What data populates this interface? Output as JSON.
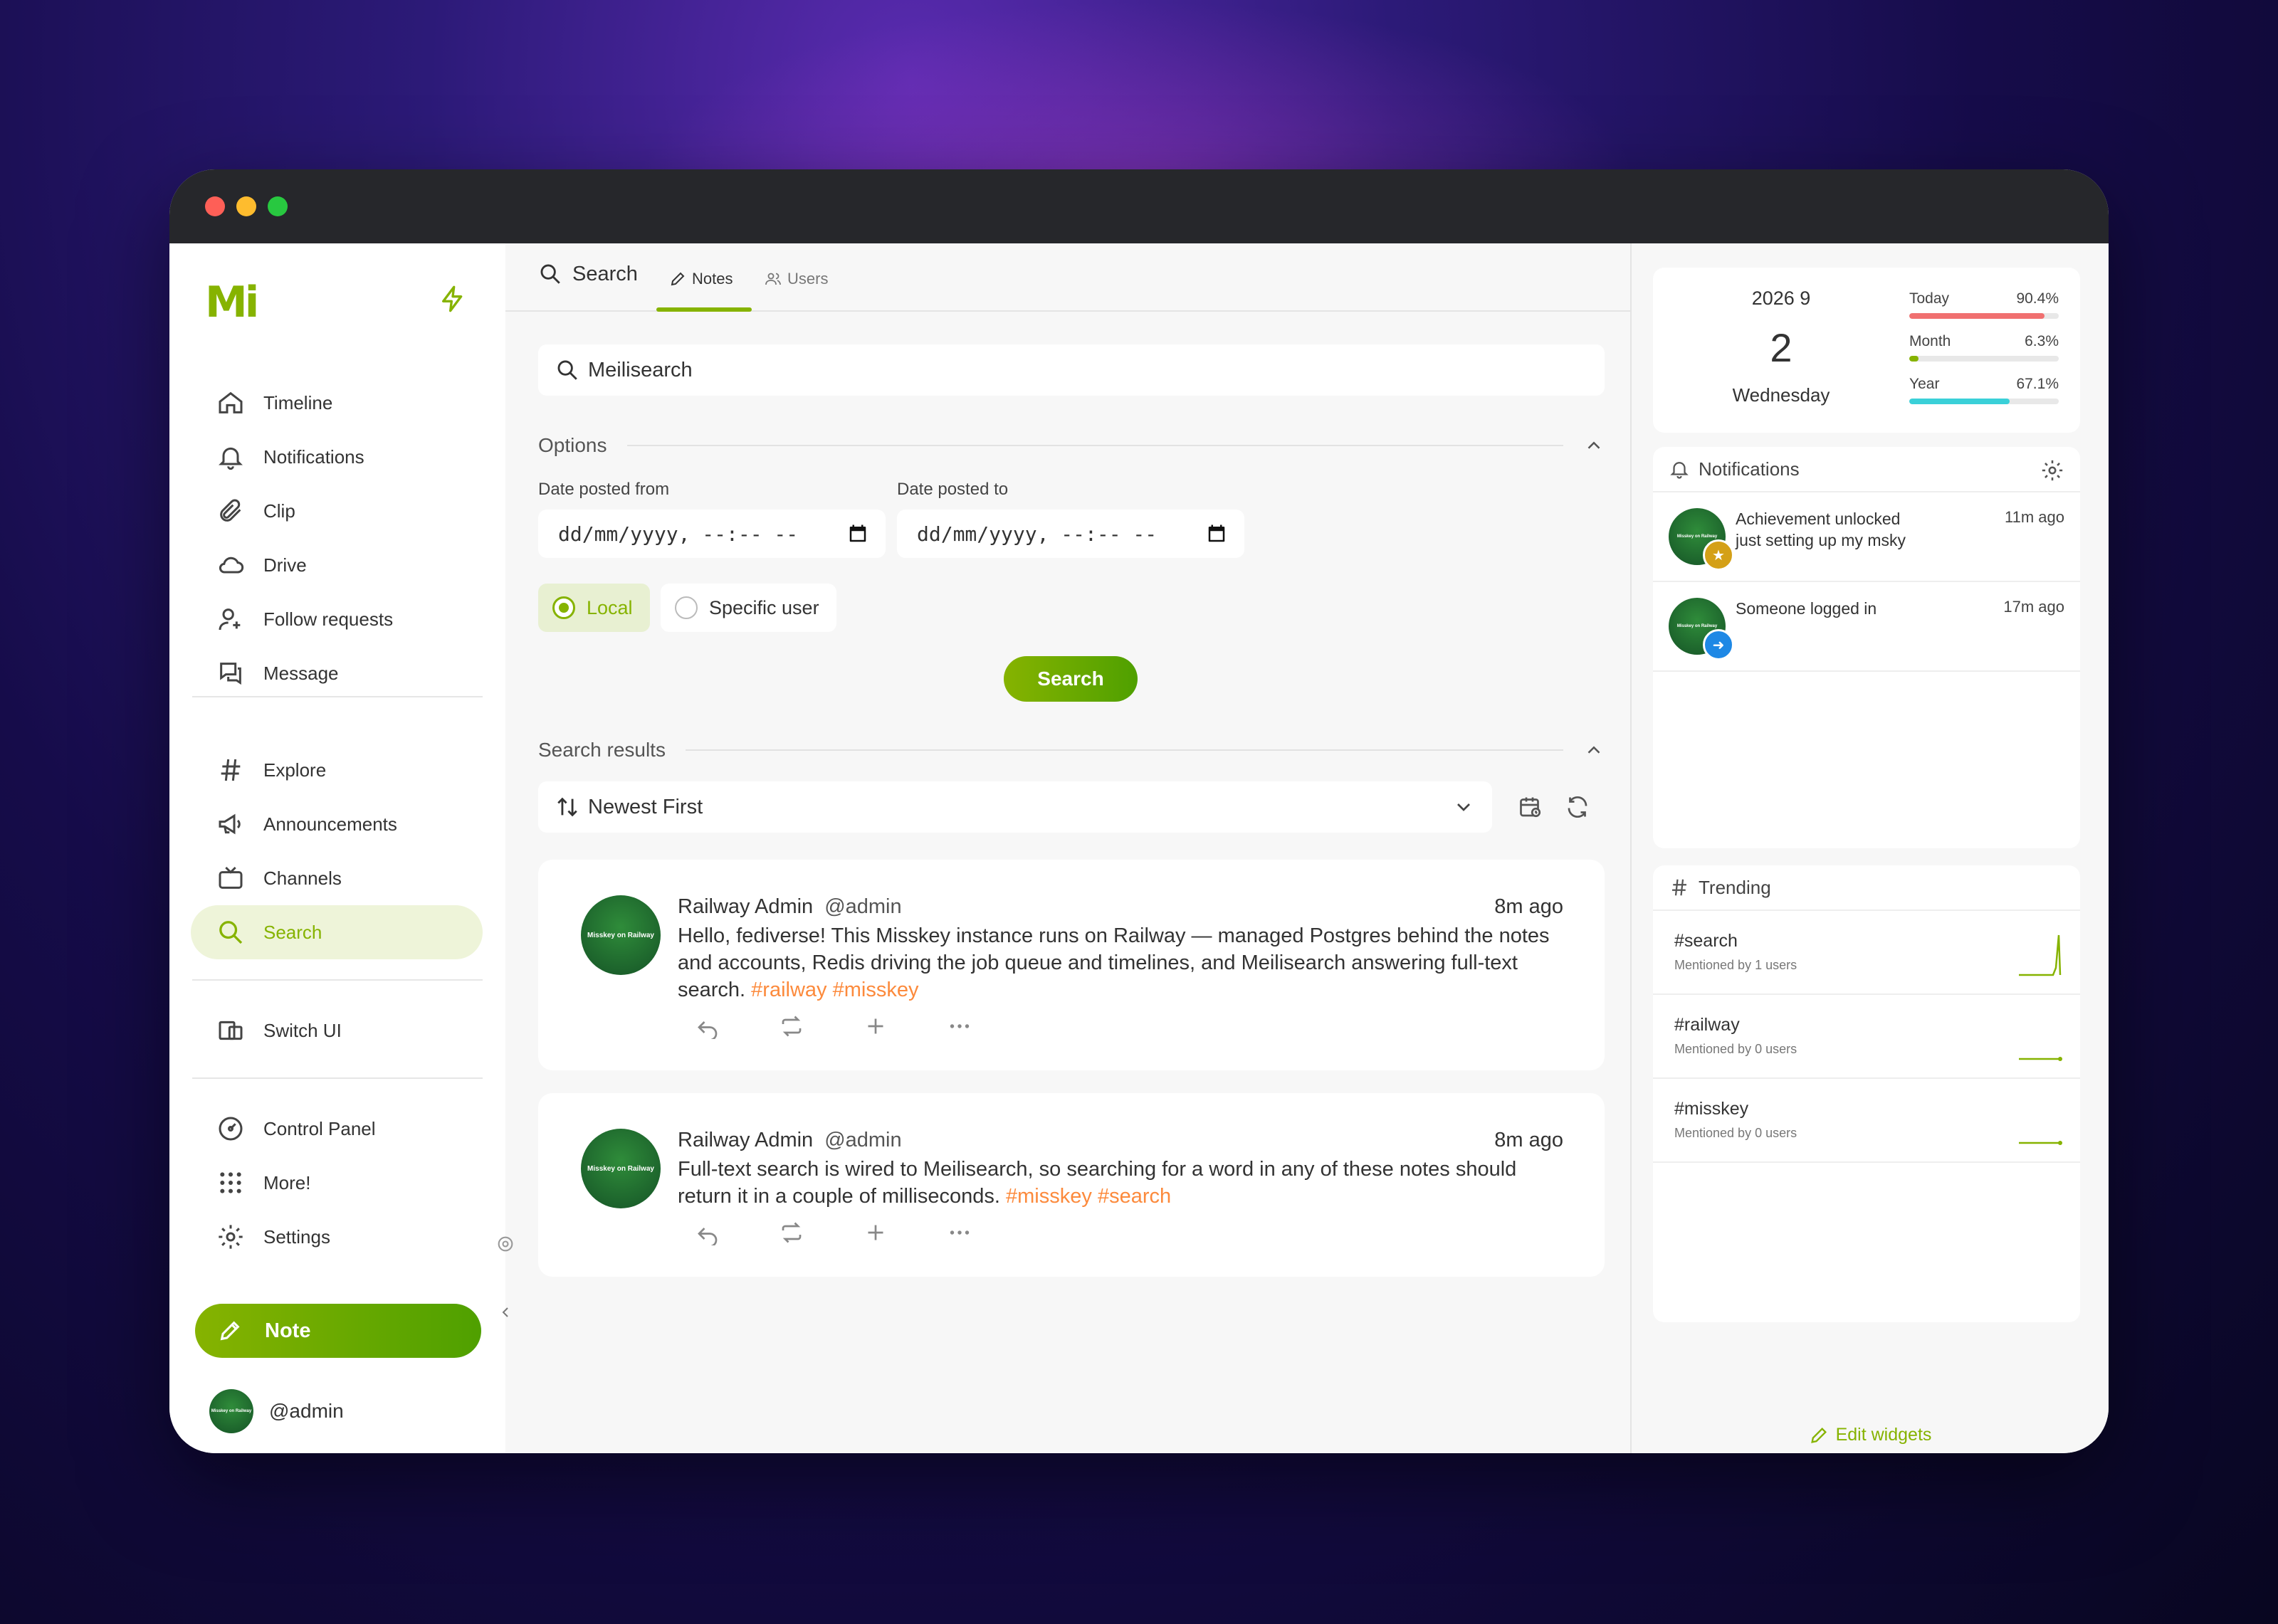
{
  "sidebar": {
    "logo": "Mi",
    "nav_primary": [
      {
        "label": "Timeline",
        "icon": "home-icon"
      },
      {
        "label": "Notifications",
        "icon": "bell-icon"
      },
      {
        "label": "Clip",
        "icon": "paperclip-icon"
      },
      {
        "label": "Drive",
        "icon": "cloud-icon"
      },
      {
        "label": "Follow requests",
        "icon": "user-plus-icon"
      },
      {
        "label": "Message",
        "icon": "message-icon"
      }
    ],
    "nav_secondary": [
      {
        "label": "Explore",
        "icon": "hash-icon"
      },
      {
        "label": "Announcements",
        "icon": "megaphone-icon"
      },
      {
        "label": "Channels",
        "icon": "tv-icon"
      },
      {
        "label": "Search",
        "icon": "search-icon"
      }
    ],
    "switch_ui": "Switch UI",
    "nav_admin": [
      {
        "label": "Control Panel",
        "icon": "dashboard-icon"
      },
      {
        "label": "More!",
        "icon": "grid-dots-icon"
      },
      {
        "label": "Settings",
        "icon": "gear-icon"
      }
    ],
    "note_button": "Note",
    "account": "@admin",
    "avatar_text": "Misskey on Railway"
  },
  "header": {
    "title": "Search",
    "tabs": [
      {
        "label": "Notes",
        "active": true
      },
      {
        "label": "Users",
        "active": false
      }
    ]
  },
  "search": {
    "query": "Meilisearch",
    "options_title": "Options",
    "date_from_label": "Date posted from",
    "date_to_label": "Date posted to",
    "date_from_value": "dd/mm/yyyy, --:-- --",
    "date_to_value": "dd/mm/yyyy, --:-- --",
    "scope_local": "Local",
    "scope_user": "Specific user",
    "scope_selected": "Local",
    "submit": "Search"
  },
  "results": {
    "title": "Search results",
    "sort": "Newest First",
    "notes": [
      {
        "name": "Railway Admin",
        "username": "@admin",
        "time": "8m ago",
        "text": "Hello, fediverse! This Misskey instance runs on Railway — managed Postgres behind the notes and accounts, Redis driving the job queue and timelines, and Meilisearch answering full-text search.",
        "tags": [
          "#railway",
          "#misskey"
        ]
      },
      {
        "name": "Railway Admin",
        "username": "@admin",
        "time": "8m ago",
        "text": "Full-text search is wired to Meilisearch, so searching for a word in any of these notes should return it in a couple of milliseconds.",
        "tags": [
          "#misskey",
          "#search"
        ]
      }
    ]
  },
  "widgets": {
    "calendar": {
      "year_month": "2026  9",
      "day": "2",
      "weekday": "Wednesday",
      "progress": [
        {
          "label": "Today",
          "value": "90.4%",
          "fraction": 0.904,
          "color": "#f07070"
        },
        {
          "label": "Month",
          "value": "6.3%",
          "fraction": 0.063,
          "color": "#86b300"
        },
        {
          "label": "Year",
          "value": "67.1%",
          "fraction": 0.671,
          "color": "#3ad0d8"
        }
      ]
    },
    "notifications": {
      "title": "Notifications",
      "items": [
        {
          "line1": "Achievement unlocked",
          "line2": "just setting up my msky",
          "time": "11m ago",
          "badge_color": "#d4a017",
          "badge_icon": "medal-icon"
        },
        {
          "line1": "Someone logged in",
          "line2": "",
          "time": "17m ago",
          "badge_color": "#1e88e5",
          "badge_icon": "login-icon"
        }
      ]
    },
    "trending": {
      "title": "Trending",
      "items": [
        {
          "tag": "#search",
          "sub": "Mentioned by 1 users"
        },
        {
          "tag": "#railway",
          "sub": "Mentioned by 0 users"
        },
        {
          "tag": "#misskey",
          "sub": "Mentioned by 0 users"
        }
      ]
    },
    "edit": "Edit widgets"
  },
  "colors": {
    "accent": "#86b300",
    "hashtag": "#fc8a3c"
  }
}
